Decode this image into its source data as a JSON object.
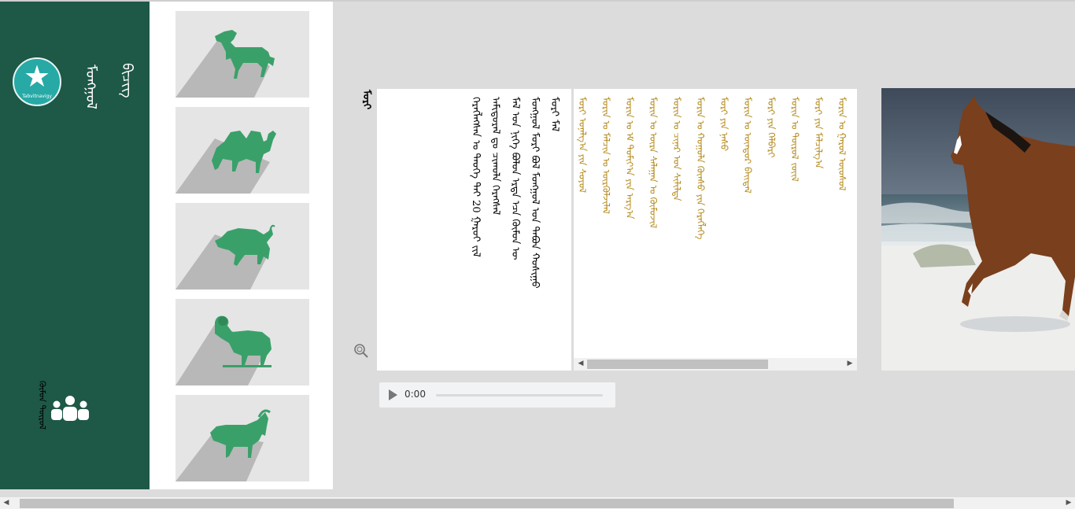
{
  "sidebar": {
    "logo": {
      "text": "Tabvitnavigy",
      "icon": "star-icon"
    },
    "brand_words": [
      "ᠮᠣᠩᠭᠣᠯ",
      "ᠪᠢᠴᠢᠭ"
    ],
    "people": {
      "label": "ᠬᠦᠮᠦᠨ ᠲᠥᠷᠥᠯ",
      "icon": "people-icon"
    },
    "colors": {
      "background": "#1e5846",
      "logo": "#27a9a6"
    }
  },
  "animals": [
    {
      "name": "horse",
      "icon": "horse-icon"
    },
    {
      "name": "camel",
      "icon": "camel-icon"
    },
    {
      "name": "cattle",
      "icon": "bull-icon"
    },
    {
      "name": "sheep",
      "icon": "ram-icon"
    },
    {
      "name": "goat",
      "icon": "goat-icon"
    }
  ],
  "content": {
    "title": "ᠮᠣᠷᠢ",
    "text_columns": [
      "ᠮᠣᠷᠢ ᠮᠠᠯ",
      "ᠮᠣᠩᠭᠣᠯ ᠮᠣᠷᠢ ᠪᠣᠯ ᠮᠣᠩᠭᠣᠯ ᠤᠨ ᠲᠠᠪᠤᠨ ᠬᠣᠰᠢᠭᠤ",
      "ᠮᠠᠯ ᠤᠨ ᠨᠢᠭᠡ ᠪᠣᠯᠤᠨ ᠡᠷᠲᠡ ᠡᠴᠡ ᠬᠦᠮᠦᠨ ᠦ",
      "ᠠᠮᠢᠳᠤᠷᠠᠯ ᠳᠤ ᠴᠢᠬᠤᠯᠠ ᠬᠡᠷᠡᠭᠰᠡᠯ",
      "ᠬᠡᠷᠡᠭᠯᠡᠭᠰᠡᠨ ᠤ ᠲᠡᠦᠬᠡ ᠲᠠᠢ 20 ᠭᠠᠷᠤᠢ ᠵᠢᠯ"
    ],
    "zoom_icon": "magnifier-icon",
    "list_items": [
      "ᠮᠣᠷᠢᠨ ᠤ ᠭᠠᠷᠤᠯ ᠦᠦᠰᠦᠯ",
      "ᠮᠣᠷᠢ ᠶᠢᠨ ᠮᠠᠯᠴᠢᠯᠭ᠎ᠠ",
      "ᠮᠣᠷᠢᠨ ᠤ ᠲᠥᠷᠥᠯ ᠵᠦᠢᠯ",
      "ᠮᠣᠷᠢ ᠶᠢᠨ ᠬᠡᠯᠪᠡᠷᠢ",
      "ᠮᠣᠷᠢᠨ ᠤ ᠦᠨᠳᠦᠷ ᠪᠠᠢᠳᠠᠯ",
      "ᠮᠣᠷᠢ ᠶᠢᠨ ᠨᠠᠰᠤ",
      "ᠮᠣᠷᠢᠨ ᠤ ᠬᠣᠭᠣᠯᠠ ᠬᠦᠨᠰᠦ ᠶᠢᠨ ᠬᠡᠷᠡᠭᠯᠡᠭᠡ",
      "ᠮᠣᠷᠢᠨ ᠤ ᠴᠢᠨᠠᠷ ᠤᠨ ᠰᠢᠯᠢᠯᠲᠡ",
      "ᠮᠣᠷᠢᠨ ᠤ ᠦᠷᠡ ᠰᠠᠯᠠᠭᠠᠨ ᠤ ᠬᠦᠮᠦᠵᠢᠯ",
      "ᠮᠣᠷᠢᠨ ᠤ ᠡᠮ ᠲᠣᠮᠢᠶ᠎ᠠ ᠶᠢᠨ ᠠᠷᠭ᠎ᠠ",
      "ᠮᠣᠷᠢᠨ ᠤ ᠮᠠᠯᠴᠢᠨ ᠤ ᠦᠷᠭᠦᠯᠵᠢᠯᠡᠯ",
      "ᠮᠣᠷᠢ ᠤᠨᠠᠯᠭ᠎ᠠ ᠶᠢᠨ ᠰᠣᠶᠣᠯ"
    ],
    "list_color": "#b58a1c"
  },
  "audio": {
    "time": "0:00",
    "progress": 0,
    "play_icon": "play-icon"
  },
  "photo": {
    "subject": "brown horse galloping on beach"
  },
  "scroll": {
    "list_thumb_fraction": 0.68,
    "page_thumb_fraction": 0.87
  }
}
